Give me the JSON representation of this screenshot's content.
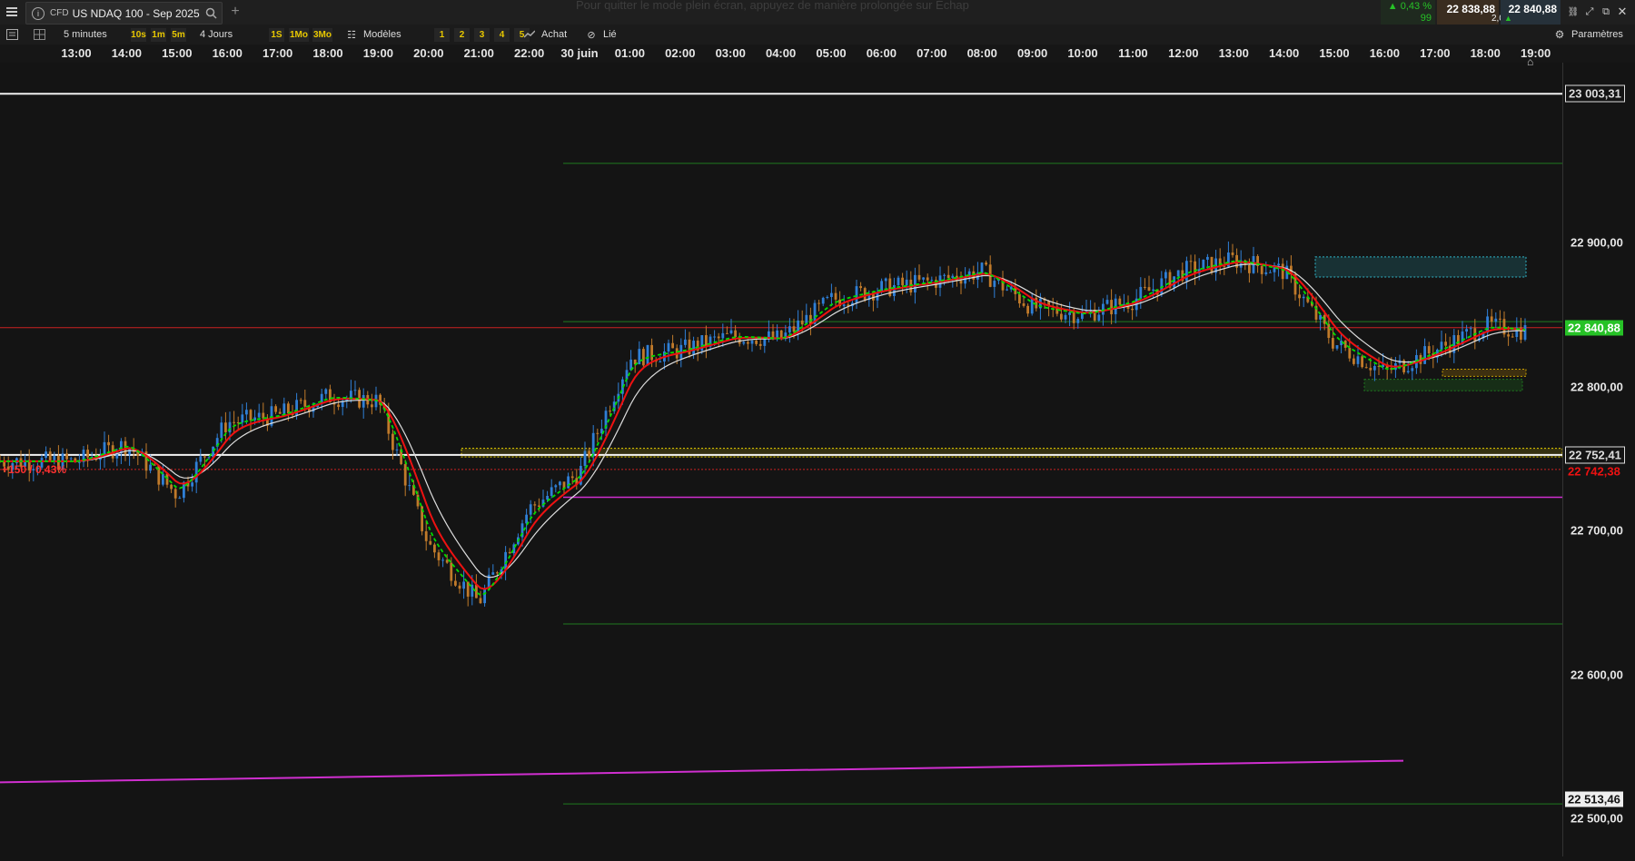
{
  "header": {
    "menu_icon": "hamburger-icon",
    "instrument_type": "CFD",
    "instrument_name": "US NDAQ 100 - Sep 2025",
    "info_icon": "info-icon",
    "search_icon": "search-icon",
    "add_tab_icon": "plus-icon",
    "fullscreen_hint": "Pour quitter le mode plein écran, appuyez de manière prolongée sur  Échap",
    "change_pct": "0,43 %",
    "change_value": "99",
    "sell_price": "22 838,88",
    "spread": "2,00",
    "buy_price": "22 840,88",
    "window_icons": [
      "link-icon",
      "expand-icon",
      "popout-icon",
      "close-icon"
    ]
  },
  "toolbar": {
    "list_icon": "list-icon",
    "layout_icon": "layout-icon",
    "interval": "5 minutes",
    "interval_shortcuts": [
      "10s",
      "1m",
      "5m"
    ],
    "range": "4 Jours",
    "range_shortcuts": [
      "1S",
      "1Mo",
      "3Mo"
    ],
    "models_label": "Modèles",
    "model_slots": [
      "1",
      "2",
      "3",
      "4",
      "5"
    ],
    "buy_label": "Achat",
    "linked_label": "Lié",
    "settings_label": "Paramètres"
  },
  "time_axis": [
    "13:00",
    "14:00",
    "15:00",
    "16:00",
    "17:00",
    "18:00",
    "19:00",
    "20:00",
    "21:00",
    "22:00",
    "30 juin",
    "01:00",
    "02:00",
    "03:00",
    "04:00",
    "05:00",
    "06:00",
    "07:00",
    "08:00",
    "09:00",
    "10:00",
    "11:00",
    "12:00",
    "13:00",
    "14:00",
    "15:00",
    "16:00",
    "17:00",
    "18:00",
    "19:00"
  ],
  "price_axis": [
    "22 900,00",
    "22 800,00",
    "22 700,00",
    "22 600,00",
    "22 500,00"
  ],
  "price_markers": {
    "white_top": "23 003,31",
    "current": "22 840,88",
    "white_mid": "22 752,41",
    "red_ref": "22 742,38",
    "bottom": "22 513,46"
  },
  "overlay_text": "+150 / 0,43%",
  "colors": {
    "bull": "#2f7fd6",
    "bear": "#c07a2a",
    "ema_fast": "#00dd00",
    "ema_mid": "#ee1111",
    "ema_slow": "#dddddd",
    "magenta": "#d02fd0",
    "zone_yellow": "#e8d000",
    "zone_cyan": "#2fb5c8",
    "current_green": "#27c227"
  },
  "chart_data": {
    "type": "candlestick",
    "symbol": "US NDAQ 100 - Sep 2025",
    "interval": "5 minutes",
    "x": [
      "13:00",
      "14:00",
      "15:00",
      "16:00",
      "17:00",
      "18:00",
      "19:00",
      "20:00",
      "21:00",
      "22:00",
      "30 juin",
      "01:00",
      "02:00",
      "03:00",
      "04:00",
      "05:00",
      "06:00",
      "07:00",
      "08:00",
      "09:00",
      "10:00",
      "11:00",
      "12:00",
      "13:00",
      "14:00",
      "15:00",
      "16:00",
      "17:00",
      "18:00",
      "19:00"
    ],
    "close": [
      22748,
      22760,
      22725,
      22775,
      22780,
      22793,
      22790,
      22690,
      22650,
      22715,
      22740,
      22820,
      22825,
      22835,
      22833,
      22860,
      22868,
      22873,
      22880,
      22855,
      22850,
      22860,
      22880,
      22888,
      22880,
      22830,
      22810,
      22825,
      22842,
      22838
    ],
    "ylim": [
      22480,
      23020
    ],
    "levels": [
      22752.41,
      22742.38,
      23003.31,
      22513.46
    ]
  }
}
